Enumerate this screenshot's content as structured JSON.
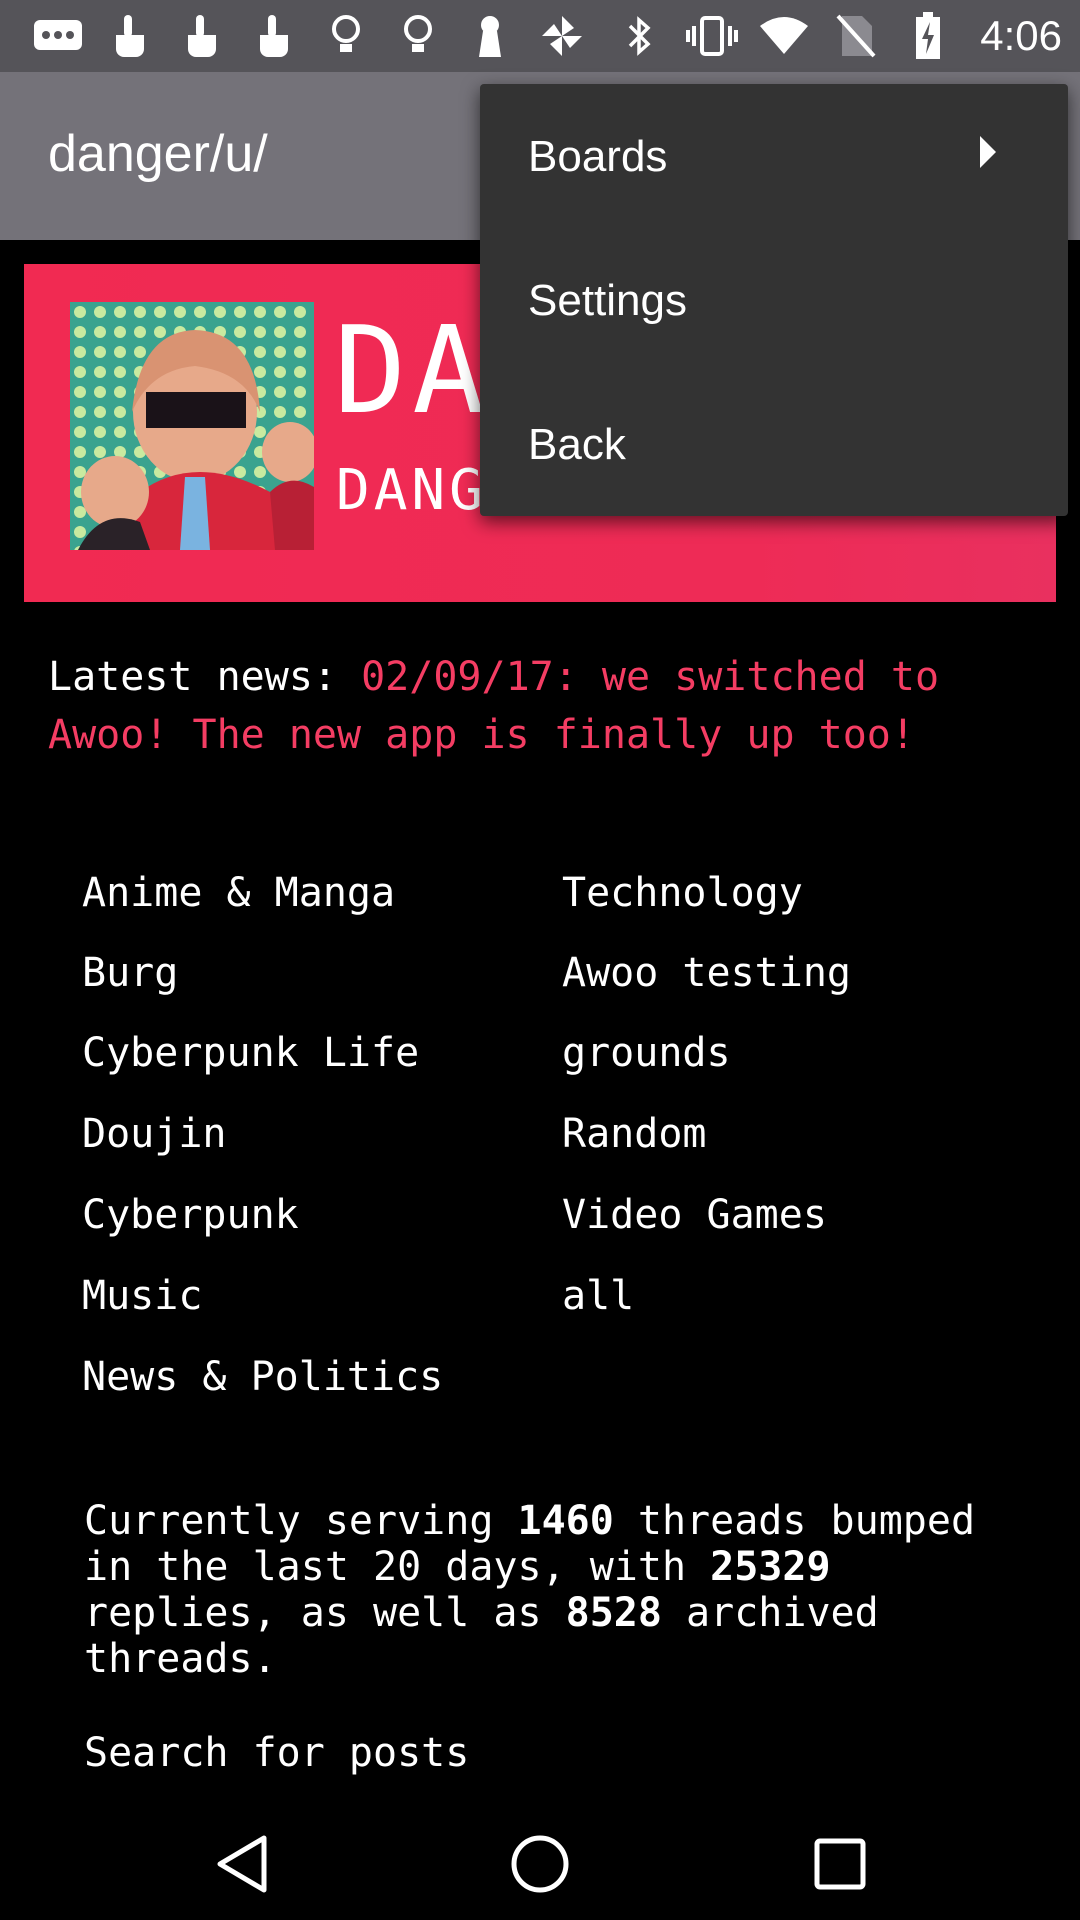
{
  "status_bar": {
    "time": "4:06",
    "left_icons": [
      "chat-icon",
      "touch-icon",
      "touch-icon",
      "touch-icon",
      "bulb-icon",
      "bulb-icon",
      "keyhole-icon",
      "pinwheel-icon"
    ],
    "right_icons": [
      "bluetooth-icon",
      "vibrate-icon",
      "wifi-icon",
      "no-sim-icon",
      "battery-charging-icon"
    ]
  },
  "app_bar": {
    "title": "danger/u/"
  },
  "banner": {
    "title": "DA",
    "subtitle": "DANG",
    "bg_color": "#f12a52"
  },
  "news": {
    "label": "Latest news:",
    "text": "02/09/17: we switched to Awoo! The new app is finally up too!"
  },
  "boards": {
    "left": [
      "Anime & Manga",
      "Burg",
      "Cyberpunk Life",
      "Doujin",
      "Cyberpunk",
      "Music",
      "News & Politics"
    ],
    "right": [
      "Technology",
      "Awoo testing",
      "grounds",
      "Random",
      "Video Games",
      "all"
    ]
  },
  "stats": {
    "p1": "Currently serving ",
    "threads": "1460",
    "p2": " threads bumped in the last 20 days, with ",
    "replies": "25329",
    "p3": " replies, as well as ",
    "archived": "8528",
    "p4": " archived threads."
  },
  "search": {
    "label": "Search for posts"
  },
  "menu": {
    "items": [
      {
        "label": "Boards",
        "has_submenu": true
      },
      {
        "label": "Settings",
        "has_submenu": false
      },
      {
        "label": "Back",
        "has_submenu": false
      }
    ]
  },
  "nav_bar": {
    "buttons": [
      "back-icon",
      "home-icon",
      "recents-icon"
    ]
  }
}
